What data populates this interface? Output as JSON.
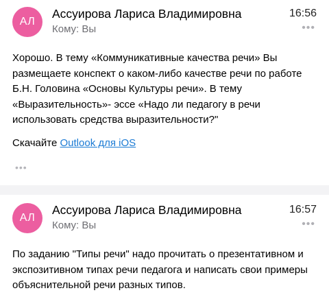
{
  "messages": [
    {
      "avatar": "АЛ",
      "sender": "Ассуирова Лариса Владимировна",
      "time": "16:56",
      "to": "Кому: Вы",
      "more": "•••",
      "body": "Хорошо. В тему «Коммуникативные качества речи» Вы размещаете конспект о каком-либо качестве речи по работе Б.Н. Головина «Основы Культуры речи». В тему «Выразительность»- эссе «Надо ли педагогу в речи использовать средства выразительности?\"",
      "signature_prefix": "Скачайте ",
      "signature_link": "Outlook для iOS",
      "ellipsis": "•••"
    },
    {
      "avatar": "АЛ",
      "sender": "Ассуирова Лариса Владимировна",
      "time": "16:57",
      "to": "Кому: Вы",
      "more": "•••",
      "body": "По заданию \"Типы речи\" надо прочитать о презентативном и экспозитивном типах речи педагога и написать свои примеры объяснительной речи разных типов."
    }
  ],
  "colors": {
    "avatar_bg": "#ec5ea0",
    "link": "#1a7ad4",
    "separator": "#f3f3f5"
  }
}
